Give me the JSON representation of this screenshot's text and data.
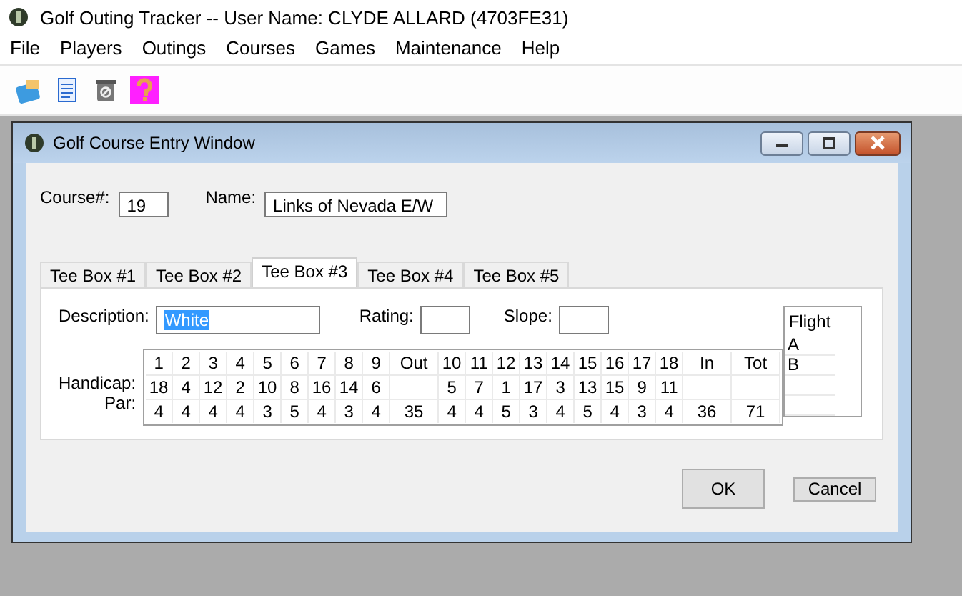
{
  "app": {
    "title": "Golf Outing Tracker -- User Name: CLYDE ALLARD (4703FE31)"
  },
  "menu": [
    "File",
    "Players",
    "Outings",
    "Courses",
    "Games",
    "Maintenance",
    "Help"
  ],
  "dialog": {
    "title": "Golf Course Entry Window",
    "course_number": {
      "label": "Course#:",
      "value": "19"
    },
    "name": {
      "label": "Name:",
      "value": "Links of Nevada E/W"
    },
    "tabs": [
      {
        "label": "Tee Box #1",
        "selected": false
      },
      {
        "label": "Tee Box #2",
        "selected": false
      },
      {
        "label": "Tee Box #3",
        "selected": true
      },
      {
        "label": "Tee Box #4",
        "selected": false
      },
      {
        "label": "Tee Box #5",
        "selected": false
      }
    ],
    "description": {
      "label": "Description:",
      "value": "White",
      "selected": true
    },
    "rating": {
      "label": "Rating:"
    },
    "slope": {
      "label": "Slope:"
    },
    "row_labels": [
      "Handicap:",
      "Par:"
    ],
    "scorecard": [
      {
        "hole": "1",
        "handicap": "18",
        "par": "4"
      },
      {
        "hole": "2",
        "handicap": "4",
        "par": "4"
      },
      {
        "hole": "3",
        "handicap": "12",
        "par": "4"
      },
      {
        "hole": "4",
        "handicap": "2",
        "par": "4"
      },
      {
        "hole": "5",
        "handicap": "10",
        "par": "3"
      },
      {
        "hole": "6",
        "handicap": "8",
        "par": "5"
      },
      {
        "hole": "7",
        "handicap": "16",
        "par": "4"
      },
      {
        "hole": "8",
        "handicap": "14",
        "par": "3"
      },
      {
        "hole": "9",
        "handicap": "6",
        "par": "4"
      },
      {
        "hole": "Out",
        "par": "35"
      },
      {
        "hole": "10",
        "handicap": "5",
        "par": "4"
      },
      {
        "hole": "11",
        "handicap": "7",
        "par": "4"
      },
      {
        "hole": "12",
        "handicap": "1",
        "par": "5"
      },
      {
        "hole": "13",
        "handicap": "17",
        "par": "3"
      },
      {
        "hole": "14",
        "handicap": "3",
        "par": "4"
      },
      {
        "hole": "15",
        "handicap": "13",
        "par": "5"
      },
      {
        "hole": "16",
        "handicap": "15",
        "par": "4"
      },
      {
        "hole": "17",
        "handicap": "9",
        "par": "3"
      },
      {
        "hole": "18",
        "handicap": "11",
        "par": "4"
      },
      {
        "hole": "In",
        "par": "36"
      },
      {
        "hole": "Tot",
        "par": "71"
      }
    ],
    "flight": {
      "header": "Flight",
      "rows": [
        "A",
        "B"
      ]
    },
    "buttons": [
      "OK",
      "Cancel"
    ]
  }
}
